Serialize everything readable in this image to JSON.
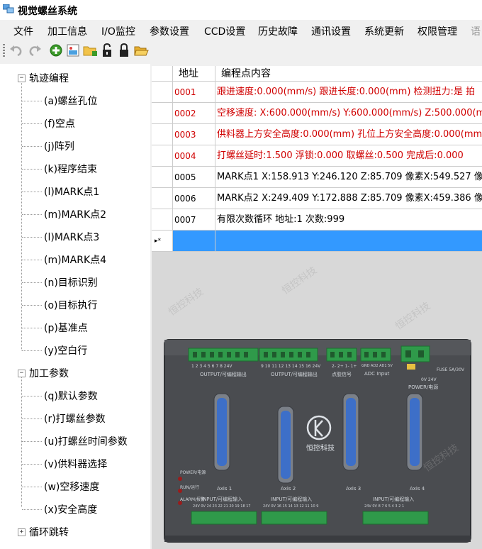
{
  "app": {
    "title": "视觉螺丝系统"
  },
  "menu": [
    "文件",
    "加工信息",
    "I/O监控",
    "参数设置",
    "CCD设置",
    "历史故障",
    "通讯设置",
    "系统更新",
    "权限管理",
    "语"
  ],
  "toolbar": [
    "undo-icon",
    "redo-icon",
    "add-green-icon",
    "image-icon",
    "folder-add-icon",
    "unlock-icon",
    "lock-icon",
    "folder-open-icon"
  ],
  "tree": {
    "group1": {
      "label": "轨迹编程",
      "expanded": true,
      "items": [
        "(a)螺丝孔位",
        "(f)空点",
        "(j)阵列",
        "(k)程序结束",
        "(l)MARK点1",
        "(m)MARK点2",
        "(l)MARK点3",
        "(m)MARK点4",
        "(n)目标识别",
        "(o)目标执行",
        "(p)基准点",
        "(y)空白行"
      ]
    },
    "group2": {
      "label": "加工参数",
      "expanded": true,
      "items": [
        "(q)默认参数",
        "(r)打螺丝参数",
        "(u)打螺丝时间参数",
        "(v)供料器选择",
        "(w)空移速度",
        "(x)安全高度"
      ]
    },
    "group3": {
      "label": "循环跳转",
      "expanded": false
    }
  },
  "grid": {
    "headers": {
      "addr": "地址",
      "content": "编程点内容"
    },
    "rows": [
      {
        "addr": "0001",
        "content": "跟进速度:0.000(mm/s) 跟进长度:0.000(mm) 检测扭力:是 拍",
        "red": true
      },
      {
        "addr": "0002",
        "content": "空移速度: X:600.000(mm/s) Y:600.000(mm/s) Z:500.000(mm",
        "red": true
      },
      {
        "addr": "0003",
        "content": "供料器上方安全高度:0.000(mm) 孔位上方安全高度:0.000(mm",
        "red": true
      },
      {
        "addr": "0004",
        "content": "打螺丝延时:1.500 浮锁:0.000 取螺丝:0.500 完成后:0.000",
        "red": true
      },
      {
        "addr": "0005",
        "content": "MARK点1 X:158.913 Y:246.120 Z:85.709 像素X:549.527 像",
        "red": false
      },
      {
        "addr": "0006",
        "content": "MARK点2 X:249.409 Y:172.888 Z:85.709 像素X:459.386 像",
        "red": false
      },
      {
        "addr": "0007",
        "content": "有限次数循环 地址:1 次数:999",
        "red": false
      }
    ],
    "new_row_marker": "▸*"
  },
  "device": {
    "brand": "恒控科技",
    "output_label1": "OUTPUT/可编程输出",
    "output_label2": "OUTPUT/可编程输出",
    "point_signal": "点胶信号",
    "adc_input": "ADC Input",
    "fuse": "FUSE 5A/30V",
    "power_cn": "POWER/电源",
    "power_v": "0V 24V",
    "axis1": "Axis 1",
    "axis2": "Axis 2",
    "axis3": "Axis 3",
    "axis4": "Axis 4",
    "led_power": "POWER/电源",
    "led_run": "RUN/运行",
    "led_alarm": "ALARM/报警",
    "input_label1": "INPUT/可编程输入",
    "input_label2": "INPUT/可编程输入",
    "input_label3": "INPUT/可编程输入",
    "out_nums1": "1  2  3  4  5  6  7  8  24V",
    "out_nums2": "9  10 11 12 13 14 15 16 24V",
    "pt_nums": "2-  2+  1-  1+",
    "adc_nums": "GND AD2 AD1 5V",
    "in_nums1": "24V 0V 24 23 22 21 20 19 18 17",
    "in_nums2": "24V 0V 16 15 14 13 12 11 10 9",
    "in_nums3": "24V 0V 8 7 6 5 4 3 2 1"
  },
  "watermark": "恒控科技"
}
